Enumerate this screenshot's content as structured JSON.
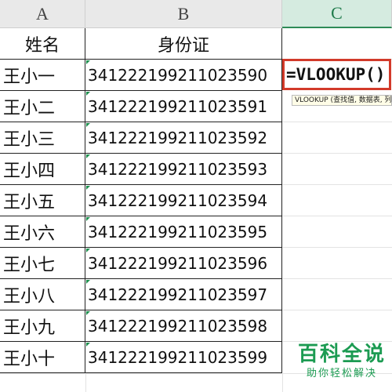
{
  "columns": {
    "a": "A",
    "b": "B",
    "c": "C"
  },
  "headers": {
    "name": "姓名",
    "id_number": "身份证"
  },
  "rows": [
    {
      "name": "王小一",
      "id": "341222199211023590"
    },
    {
      "name": "王小二",
      "id": "341222199211023591"
    },
    {
      "name": "王小三",
      "id": "341222199211023592"
    },
    {
      "name": "王小四",
      "id": "341222199211023593"
    },
    {
      "name": "王小五",
      "id": "341222199211023594"
    },
    {
      "name": "王小六",
      "id": "341222199211023595"
    },
    {
      "name": "王小七",
      "id": "341222199211023596"
    },
    {
      "name": "王小八",
      "id": "341222199211023597"
    },
    {
      "name": "王小九",
      "id": "341222199211023598"
    },
    {
      "name": "王小十",
      "id": "341222199211023599"
    }
  ],
  "formula": {
    "value": "=VLOOKUP()",
    "tooltip": "VLOOKUP (查找值, 数据表, 列序数, [匹配条件])"
  },
  "watermark": {
    "main": "百科全说",
    "sub": "助你轻松解决"
  },
  "colors": {
    "accent_green": "#1c9b52",
    "formula_border": "#d23a2a"
  }
}
